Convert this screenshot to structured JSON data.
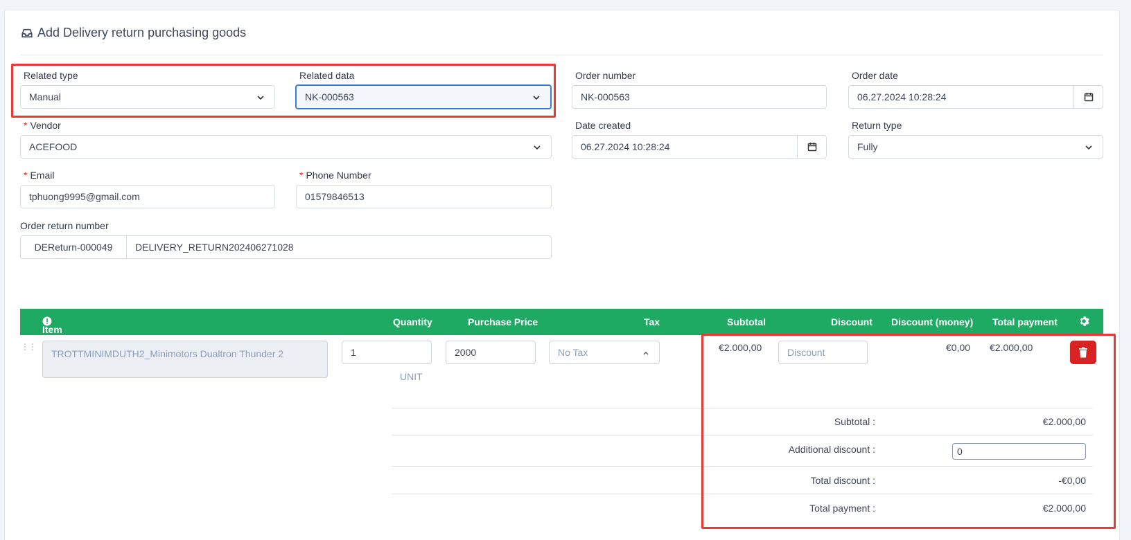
{
  "page": {
    "title": "Add Delivery return purchasing goods"
  },
  "form": {
    "related_type": {
      "label": "Related type",
      "value": "Manual"
    },
    "related_data": {
      "label": "Related data",
      "value": "NK-000563"
    },
    "order_number": {
      "label": "Order number",
      "value": "NK-000563"
    },
    "order_date": {
      "label": "Order date",
      "value": "06.27.2024 10:28:24"
    },
    "vendor": {
      "label": "Vendor",
      "required_mark": "*",
      "value": "ACEFOOD"
    },
    "date_created": {
      "label": "Date created",
      "value": "06.27.2024 10:28:24"
    },
    "return_type": {
      "label": "Return type",
      "value": "Fully"
    },
    "email": {
      "label": "Email",
      "required_mark": "*",
      "value": "tphuong9995@gmail.com"
    },
    "phone": {
      "label": "Phone Number",
      "required_mark": "*",
      "value": "01579846513"
    },
    "order_return_number": {
      "label": "Order return number",
      "prefix": "DEReturn-000049",
      "value": "DELIVERY_RETURN202406271028"
    }
  },
  "table": {
    "headers": {
      "item": "Item",
      "quantity": "Quantity",
      "purchase_price": "Purchase Price",
      "tax": "Tax",
      "subtotal": "Subtotal",
      "discount": "Discount",
      "discount_money": "Discount (money)",
      "total_payment": "Total payment"
    },
    "row": {
      "item": "TROTTMINIMDUTH2_Minimotors Dualtron Thunder 2",
      "quantity": "1",
      "unit": "UNIT",
      "price": "2000",
      "tax": "No Tax",
      "subtotal": "€2.000,00",
      "discount_placeholder": "Discount",
      "discount_money": "€0,00",
      "total_payment": "€2.000,00"
    }
  },
  "summary": {
    "subtotal_label": "Subtotal :",
    "subtotal_value": "€2.000,00",
    "additional_discount_label": "Additional discount :",
    "additional_discount_value": "0",
    "total_discount_label": "Total discount :",
    "total_discount_value": "-€0,00",
    "total_payment_label": "Total payment :",
    "total_payment_value": "€2.000,00"
  },
  "colors": {
    "header_green": "#1faa63",
    "delete_red": "#d92323",
    "highlight_red": "#e53935",
    "focus_blue": "#3b7ddd"
  }
}
